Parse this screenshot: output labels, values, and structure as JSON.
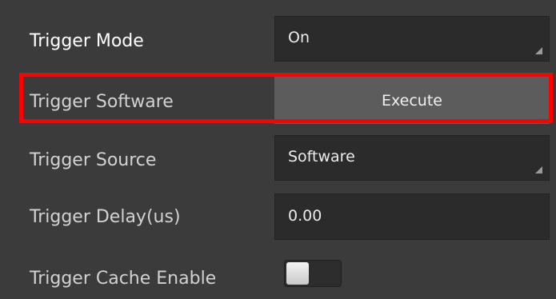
{
  "properties": {
    "trigger_mode": {
      "label": "Trigger Mode",
      "value": "On"
    },
    "trigger_software": {
      "label": "Trigger Software",
      "button_label": "Execute"
    },
    "trigger_source": {
      "label": "Trigger Source",
      "value": "Software"
    },
    "trigger_delay": {
      "label": "Trigger Delay(us)",
      "value": "0.00"
    },
    "trigger_cache_enable": {
      "label": "Trigger Cache Enable",
      "enabled": false
    }
  },
  "colors": {
    "background": "#3b3b3b",
    "field_background": "#2b2b2b",
    "button_background": "#5c5c5c",
    "highlight": "#ff0000"
  },
  "icons": {
    "dropdown_corner": "resize-corner-icon"
  }
}
